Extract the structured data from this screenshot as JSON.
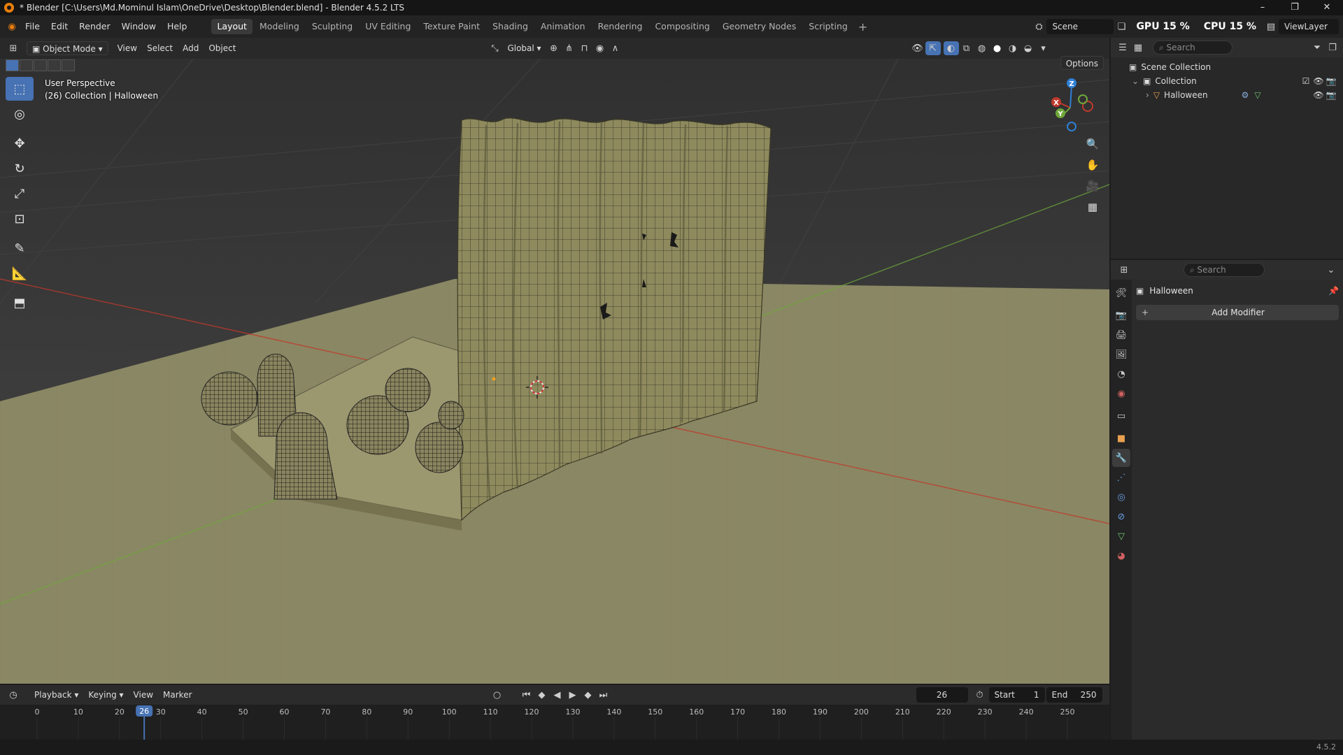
{
  "window": {
    "title": "* Blender [C:\\Users\\Md.Mominul Islam\\OneDrive\\Desktop\\Blender.blend] - Blender 4.5.2 LTS",
    "minimize": "–",
    "maximize": "❐",
    "close": "✕"
  },
  "menu": [
    "File",
    "Edit",
    "Render",
    "Window",
    "Help"
  ],
  "workspaces": [
    "Layout",
    "Modeling",
    "Sculpting",
    "UV Editing",
    "Texture Paint",
    "Shading",
    "Animation",
    "Rendering",
    "Compositing",
    "Geometry Nodes",
    "Scripting"
  ],
  "active_workspace": "Layout",
  "topbar_right": {
    "scene": "Scene",
    "gpu": "GPU 15 %",
    "cpu": "CPU 15 %",
    "viewlayer": "ViewLayer"
  },
  "viewport": {
    "mode": "Object Mode",
    "menus": [
      "View",
      "Select",
      "Add",
      "Object"
    ],
    "transform_orientation": "Global",
    "options": "Options",
    "info_line1": "User Perspective",
    "info_line2": "(26) Collection | Halloween",
    "axes": {
      "x": "X",
      "y": "Y",
      "z": "Z"
    },
    "icons": {
      "select": "select-box-icon",
      "cursor": "cursor-icon",
      "move": "move-icon",
      "rotate": "rotate-icon",
      "scale": "scale-icon",
      "transform": "transform-icon",
      "annotate": "annotate-icon",
      "measure": "measure-icon",
      "add_cube": "add-cube-icon"
    }
  },
  "outliner": {
    "search_placeholder": "Search",
    "scene_collection": "Scene Collection",
    "collection": "Collection",
    "object": "Halloween"
  },
  "properties": {
    "search_placeholder": "Search",
    "object_name": "Halloween",
    "add_modifier": "Add Modifier"
  },
  "timeline": {
    "menus": [
      "Playback",
      "Keying",
      "View",
      "Marker"
    ],
    "current_frame": "26",
    "start_label": "Start",
    "start": "1",
    "end_label": "End",
    "end": "250",
    "ticks": [
      "0",
      "10",
      "20",
      "30",
      "40",
      "50",
      "60",
      "70",
      "80",
      "90",
      "100",
      "110",
      "120",
      "130",
      "140",
      "150",
      "160",
      "170",
      "180",
      "190",
      "200",
      "210",
      "220",
      "230",
      "240",
      "250"
    ],
    "frame_range": [
      0,
      250
    ]
  },
  "version": "4.5.2",
  "colors": {
    "accent": "#4772b3",
    "floor": "#8a8764",
    "mesh": "#8f8a5e",
    "x_axis": "#c0392b",
    "y_axis": "#6fa83a",
    "z_axis": "#2f7fd6"
  }
}
